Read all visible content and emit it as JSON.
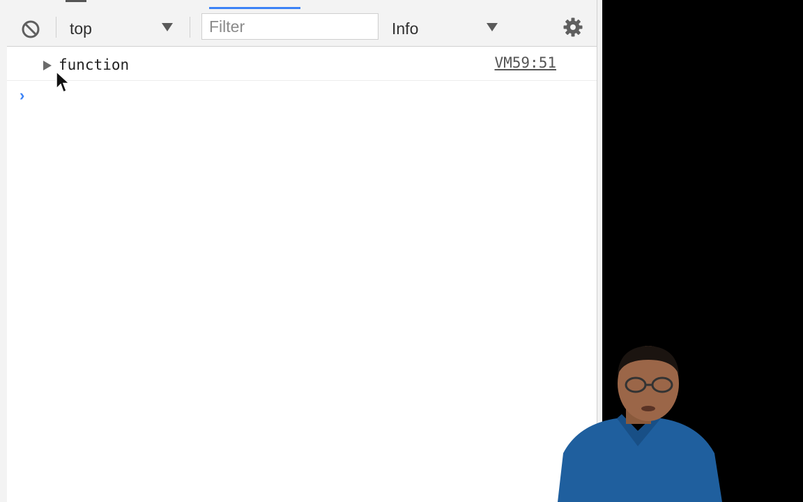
{
  "toolbar": {
    "context_select_value": "top",
    "filter_placeholder": "Filter",
    "level_select_value": "Info"
  },
  "console": {
    "log_entries": [
      {
        "text": "function",
        "source": "VM59:51"
      }
    ],
    "prompt_symbol": "›"
  },
  "colors": {
    "accent": "#3b82f6",
    "panel_bg": "#f3f3f3",
    "background": "#000000"
  },
  "icons": [
    "clear-console-icon",
    "chevron-down-icon",
    "gear-icon",
    "expand-triangle-icon",
    "mouse-pointer-icon"
  ]
}
